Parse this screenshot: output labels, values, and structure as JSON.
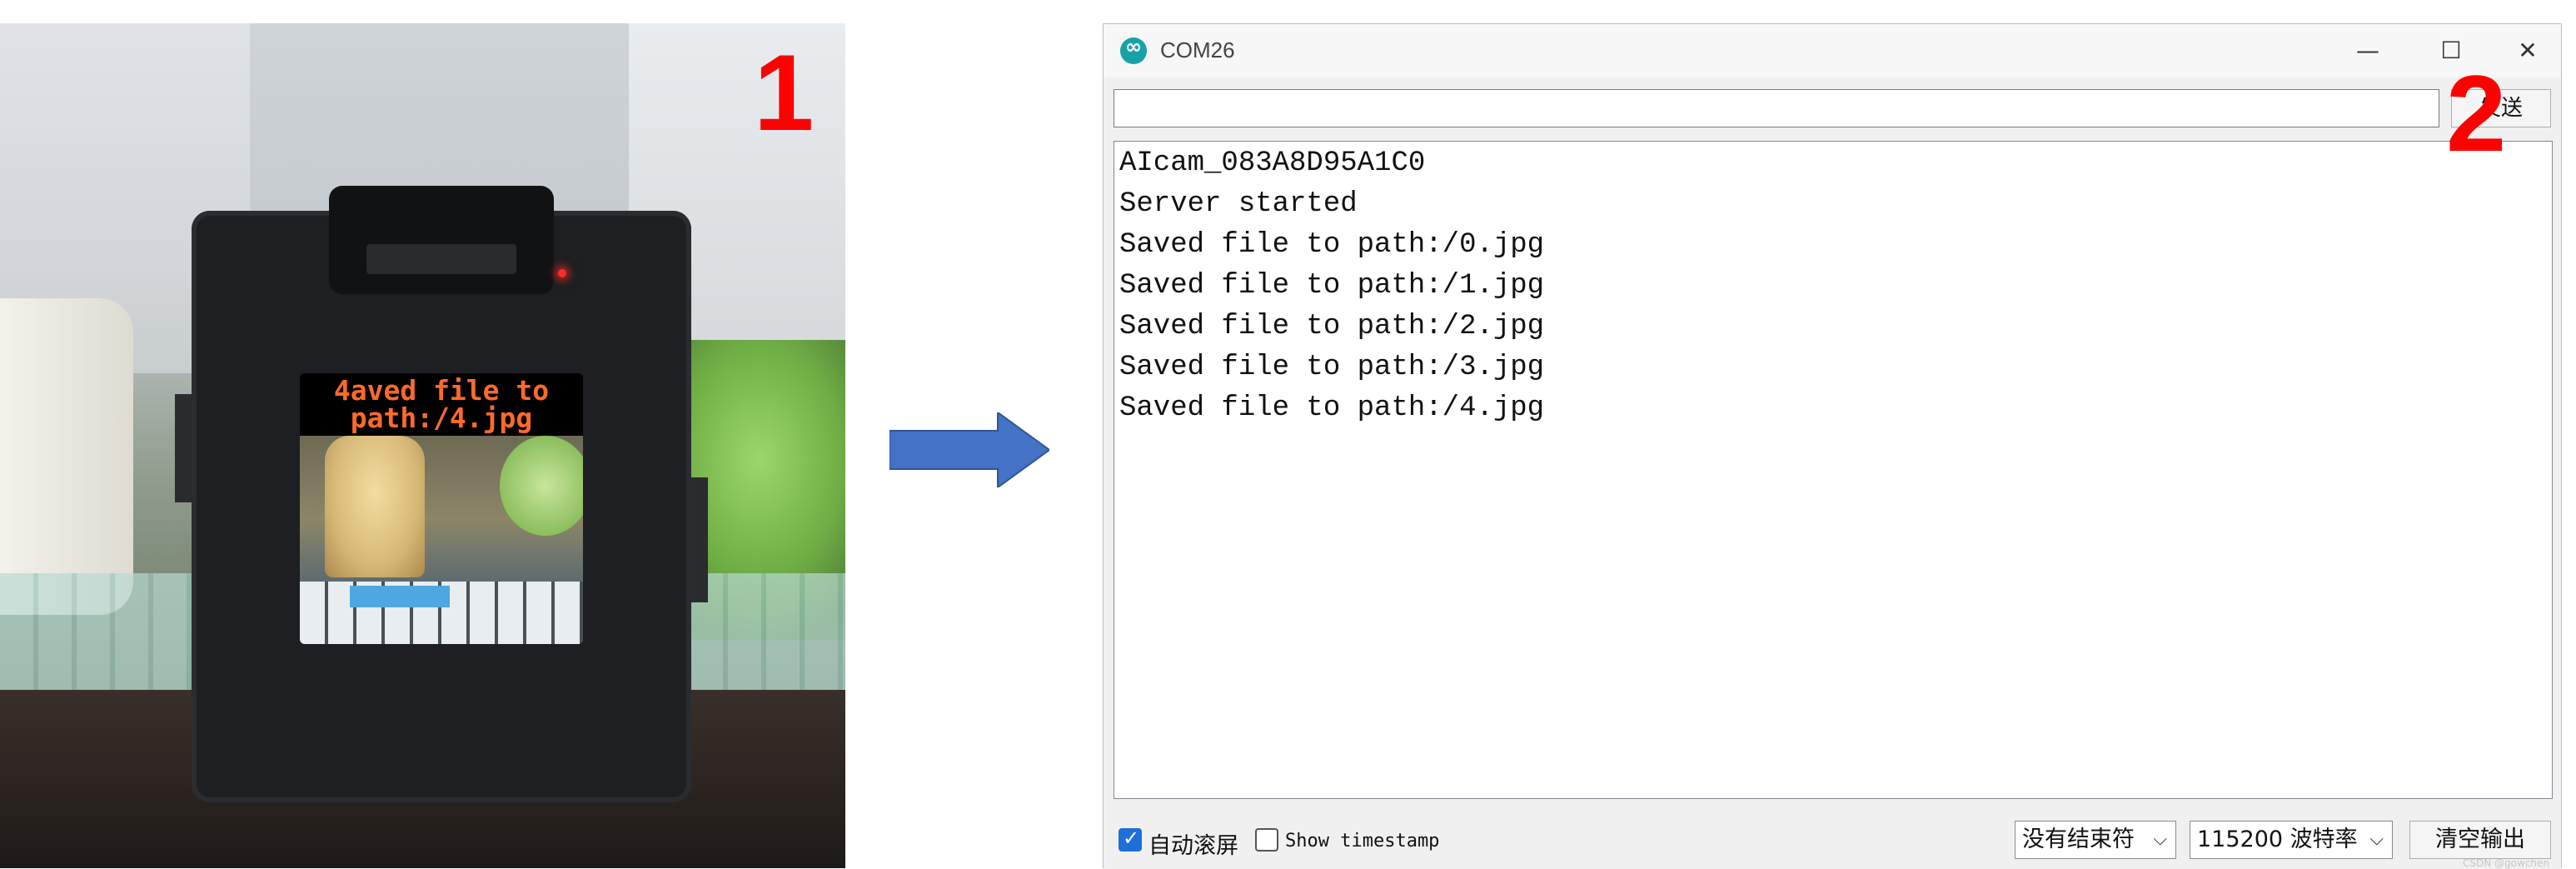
{
  "photo": {
    "screen_message": "4aved file to\npath:/4.jpg",
    "step_number": "1"
  },
  "window": {
    "title": "COM26",
    "step_number": "2",
    "controls": {
      "minimize": "—",
      "maximize": "☐",
      "close": "✕"
    },
    "send_input_value": "",
    "send_button": "发送",
    "output_lines": [
      "AIcam_083A8D95A1C0",
      "Server started",
      "Saved file to path:/0.jpg",
      "Saved file to path:/1.jpg",
      "Saved file to path:/2.jpg",
      "Saved file to path:/3.jpg",
      "Saved file to path:/4.jpg"
    ],
    "autoscroll_label": "自动滚屏",
    "autoscroll_checked": true,
    "timestamp_label": "Show timestamp",
    "timestamp_checked": false,
    "line_ending": "没有结束符",
    "baud_rate": "115200 波特率",
    "clear_button": "清空输出",
    "watermark": "CSDN @gowchen"
  },
  "colors": {
    "arrow": "#4472c4",
    "step_number": "#ff0000",
    "checkbox_checked": "#1e6fd9"
  },
  "icons": {
    "app": "arduino-icon",
    "dropdown": "chevron-down-icon"
  }
}
